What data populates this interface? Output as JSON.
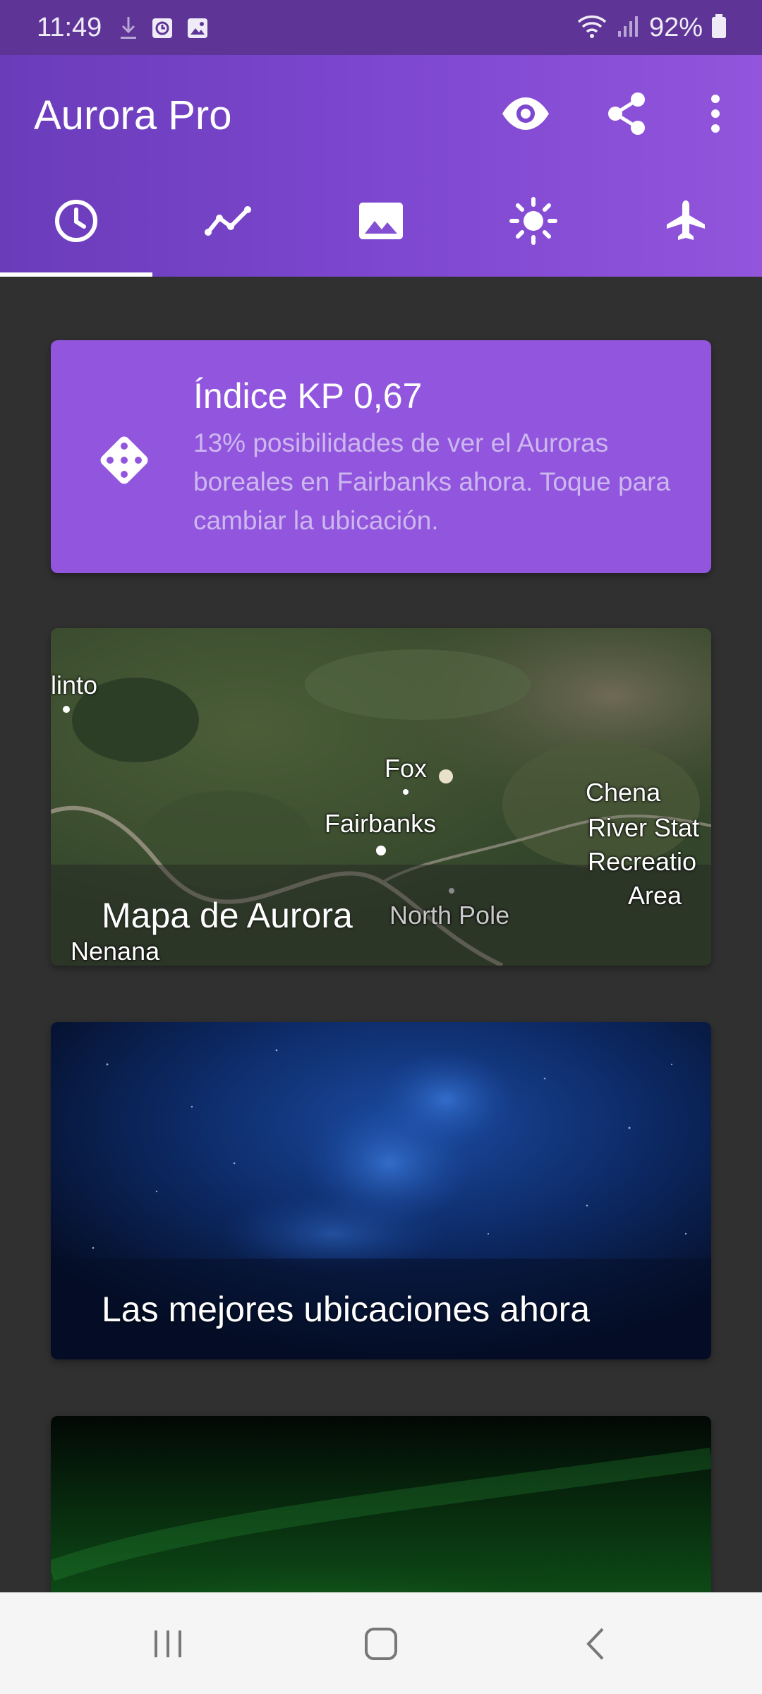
{
  "status_bar": {
    "time": "11:49",
    "battery": "92%",
    "icons_left": [
      "download-icon",
      "alarm-icon",
      "image-icon"
    ],
    "icons_right": [
      "wifi-icon",
      "signal-icon",
      "battery-icon"
    ]
  },
  "app_bar": {
    "title": "Aurora Pro",
    "actions": [
      "eye-icon",
      "share-icon",
      "more-vert-icon"
    ],
    "tabs": [
      {
        "icon": "clock-icon",
        "active": true
      },
      {
        "icon": "chart-line-icon",
        "active": false
      },
      {
        "icon": "image-icon",
        "active": false
      },
      {
        "icon": "sun-icon",
        "active": false
      },
      {
        "icon": "airplane-icon",
        "active": false
      }
    ]
  },
  "kp_card": {
    "title": "Índice KP 0,67",
    "description": "13% posibilidades de ver el Auroras boreales en Fairbanks ahora. Toque para cambiar la ubicación.",
    "icon": "dice-icon"
  },
  "map_card": {
    "title": "Mapa de Aurora",
    "place_labels": {
      "healy": "linto",
      "fox": "Fox",
      "fairbanks": "Fairbanks",
      "north_pole": "North Pole",
      "nenana": "Nenana",
      "chena_1": "Chena",
      "chena_2": "River Stat",
      "chena_3": "Recreatio",
      "chena_4": "Area"
    }
  },
  "best_card": {
    "title": "Las mejores ubicaciones ahora"
  },
  "nav_bar": {
    "buttons": [
      "recents-icon",
      "home-icon",
      "back-icon"
    ]
  },
  "colors": {
    "status_bar": "#5e3597",
    "app_bar_start": "#6a3cba",
    "app_bar_end": "#9255dc",
    "kp_card": "#9156dd",
    "background": "#303030"
  }
}
